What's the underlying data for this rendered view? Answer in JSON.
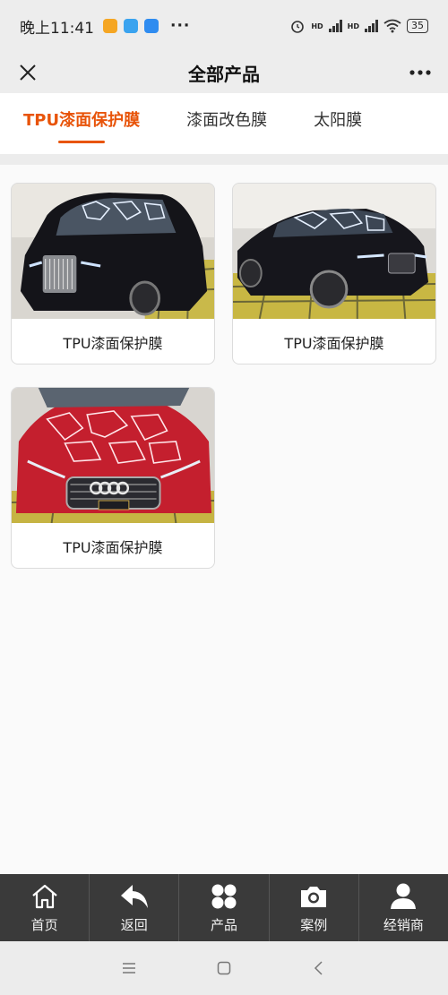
{
  "status_bar": {
    "time": "晚上11:41",
    "more": "···",
    "network_hd_1": "HD",
    "network_hd_2": "HD",
    "battery": "35",
    "app_icon_colors": [
      "#f5a623",
      "#3aa3ef",
      "#2f8cf0"
    ]
  },
  "title_bar": {
    "title": "全部产品"
  },
  "tabs": [
    {
      "label": "TPU漆面保护膜",
      "active": true
    },
    {
      "label": "漆面改色膜",
      "active": false
    },
    {
      "label": "太阳膜",
      "active": false
    }
  ],
  "products": [
    {
      "caption": "TPU漆面保护膜",
      "image": "black-mpv-photo"
    },
    {
      "caption": "TPU漆面保护膜",
      "image": "black-sedan-photo"
    },
    {
      "caption": "TPU漆面保护膜",
      "image": "red-sedan-photo"
    }
  ],
  "bottom_nav": [
    {
      "label": "首页",
      "icon": "home-icon"
    },
    {
      "label": "返回",
      "icon": "back-arrow-icon"
    },
    {
      "label": "产品",
      "icon": "grid-icon"
    },
    {
      "label": "案例",
      "icon": "camera-icon"
    },
    {
      "label": "经销商",
      "icon": "user-icon"
    }
  ],
  "colors": {
    "accent": "#e8540a",
    "nav_bg": "#3a3a3a"
  }
}
